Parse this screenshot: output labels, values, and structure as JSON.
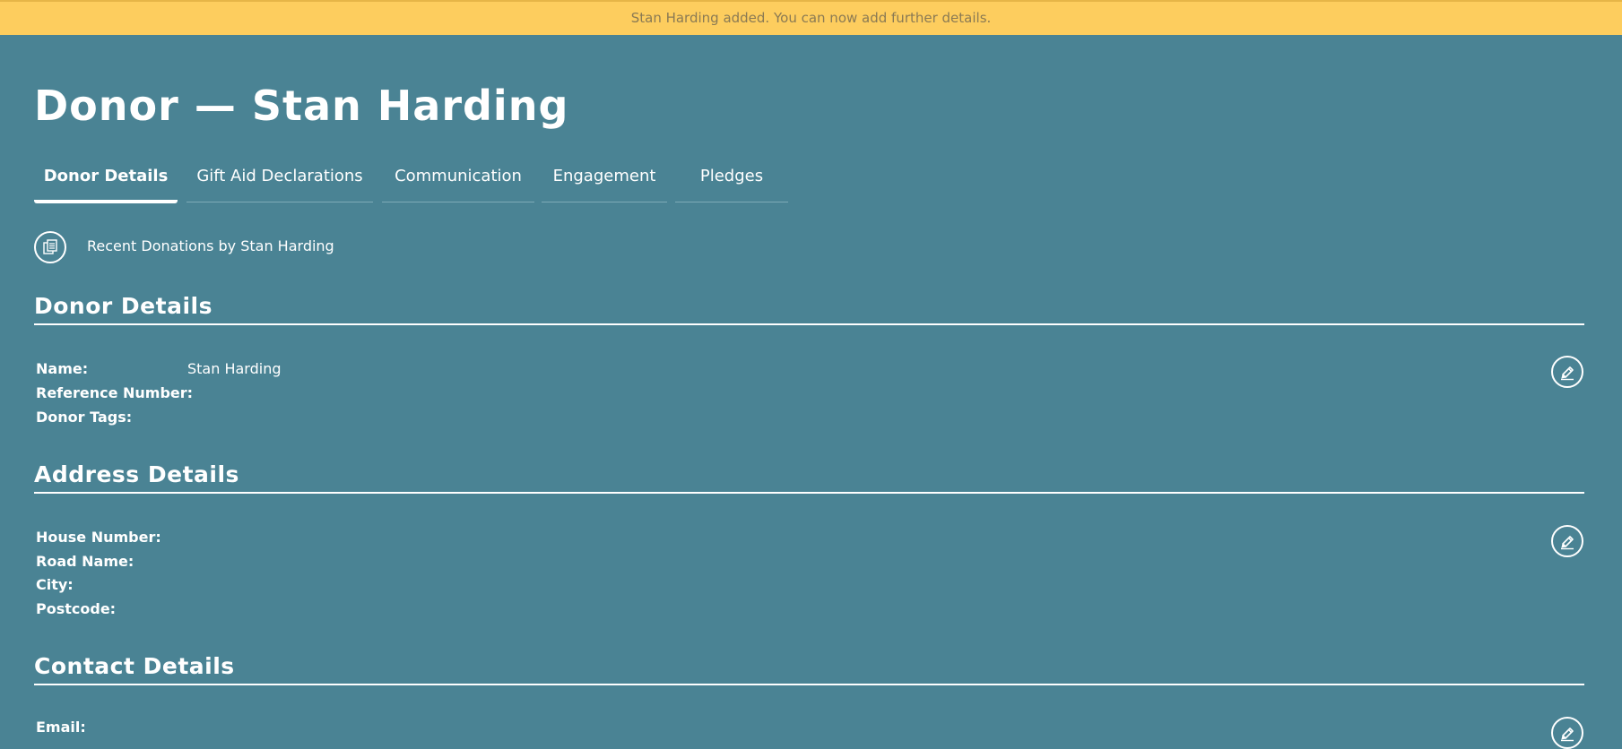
{
  "notification": {
    "message": "Stan Harding added. You can now add further details."
  },
  "page": {
    "title": "Donor — Stan Harding"
  },
  "tabs": [
    {
      "label": "Donor Details",
      "active": true
    },
    {
      "label": "Gift Aid Declarations",
      "active": false
    },
    {
      "label": "Communication",
      "active": false
    },
    {
      "label": "Engagement",
      "active": false
    },
    {
      "label": "Pledges",
      "active": false
    }
  ],
  "recent_donations": {
    "label": "Recent Donations by Stan Harding",
    "icon": "documents-icon"
  },
  "donor_details": {
    "heading": "Donor Details",
    "fields": [
      {
        "label": "Name:",
        "value": "Stan Harding"
      },
      {
        "label": "Reference Number:",
        "value": ""
      },
      {
        "label": "Donor Tags:",
        "value": ""
      }
    ],
    "edit_icon": "edit-pencil-icon"
  },
  "address_details": {
    "heading": "Address Details",
    "fields": [
      {
        "label": "House Number:",
        "value": ""
      },
      {
        "label": "Road Name:",
        "value": ""
      },
      {
        "label": "City:",
        "value": ""
      },
      {
        "label": "Postcode:",
        "value": ""
      }
    ],
    "edit_icon": "edit-pencil-icon"
  },
  "contact_details": {
    "heading": "Contact Details",
    "fields": [
      {
        "label": "Email:",
        "value": ""
      }
    ],
    "edit_icon": "edit-pencil-icon"
  },
  "colors": {
    "background": "#4a8394",
    "notice_bg": "#fdcd5e",
    "notice_text": "#8a7a54",
    "text": "#ffffff"
  }
}
